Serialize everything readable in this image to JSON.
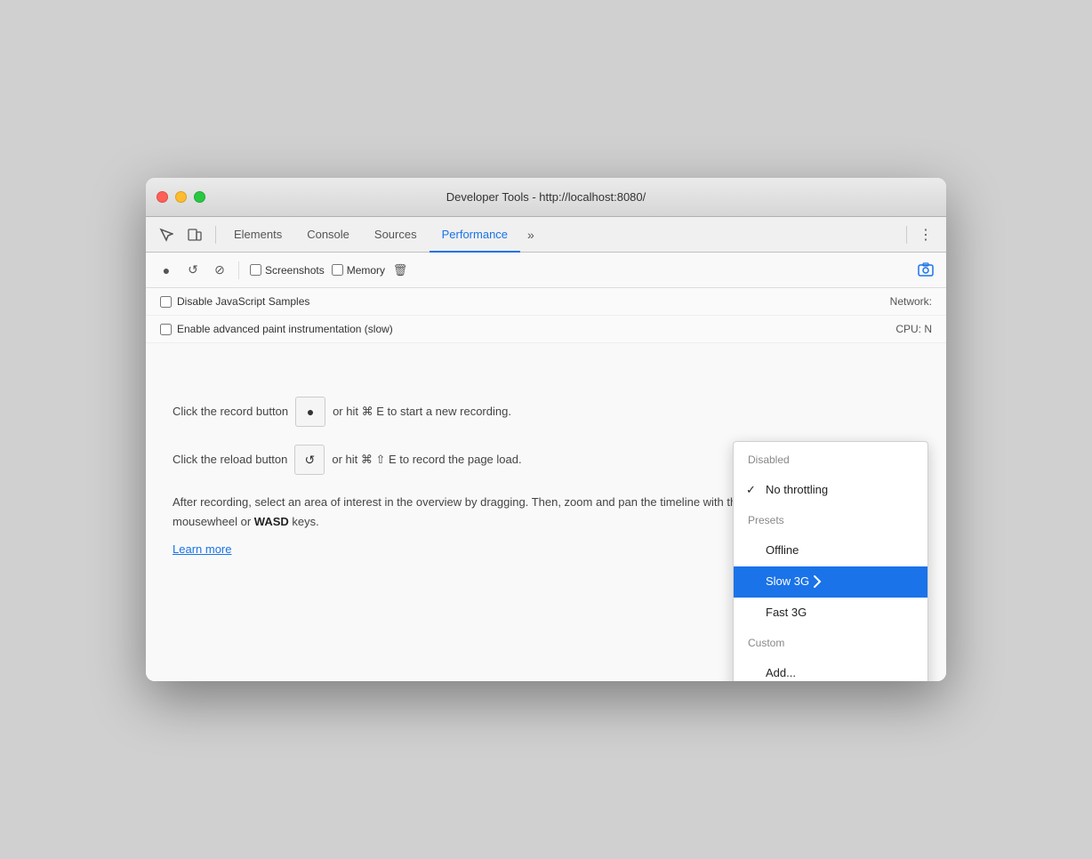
{
  "window": {
    "title": "Developer Tools - http://localhost:8080/"
  },
  "tabs_bar": {
    "elements_label": "Elements",
    "console_label": "Console",
    "sources_label": "Sources",
    "performance_label": "Performance",
    "more_tabs_label": "»",
    "menu_label": "⋮"
  },
  "toolbar": {
    "record_label": "●",
    "reload_label": "↺",
    "clear_label": "⊘",
    "screenshots_label": "Screenshots",
    "memory_label": "Memory",
    "delete_label": "🗑",
    "capture_label": "📷"
  },
  "settings": {
    "disable_js_label": "Disable JavaScript Samples",
    "network_label": "Network:",
    "paint_label": "Enable advanced paint instrumentation (slow)",
    "cpu_label": "CPU: N"
  },
  "main": {
    "record_line1_before": "Click the record button",
    "record_line1_after": "or hit ⌘ E to start a new recording.",
    "reload_line_before": "Click the reload button",
    "reload_line_after": "or hit ⌘ ⇧ E to record the page load.",
    "hint_text": "After recording, select an area of interest in the overview by dragging. Then, zoom and pan the timeline with the mousewheel or ",
    "hint_bold": "WASD",
    "hint_end": " keys.",
    "learn_more": "Learn more"
  },
  "dropdown": {
    "items": [
      {
        "id": "disabled",
        "label": "Disabled",
        "type": "section-header"
      },
      {
        "id": "no-throttling",
        "label": "No throttling",
        "type": "item",
        "checked": true
      },
      {
        "id": "presets",
        "label": "Presets",
        "type": "section-header"
      },
      {
        "id": "offline",
        "label": "Offline",
        "type": "item",
        "checked": false
      },
      {
        "id": "slow-3g",
        "label": "Slow 3G",
        "type": "item",
        "selected": true,
        "checked": false
      },
      {
        "id": "fast-3g",
        "label": "Fast 3G",
        "type": "item",
        "checked": false
      },
      {
        "id": "custom",
        "label": "Custom",
        "type": "section-header"
      },
      {
        "id": "add",
        "label": "Add...",
        "type": "item",
        "checked": false
      }
    ]
  },
  "colors": {
    "active_tab": "#1a73e8",
    "selected_bg": "#1a73e8",
    "check_color": "#222"
  }
}
